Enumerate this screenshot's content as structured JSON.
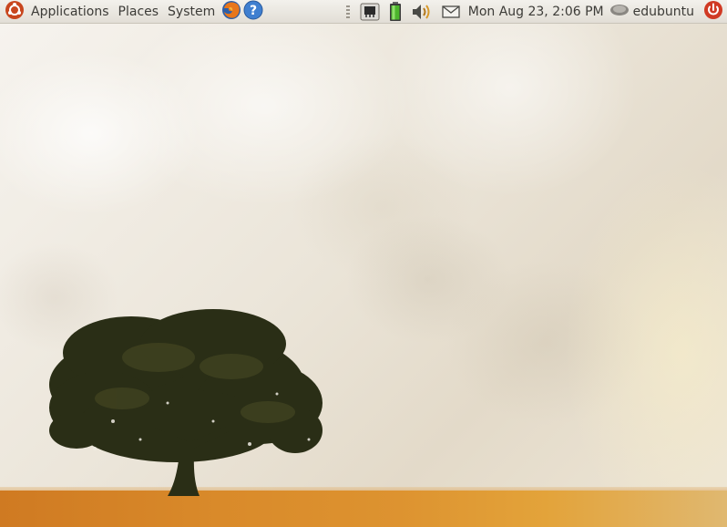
{
  "top_panel": {
    "main_menu": {
      "applications": "Applications",
      "places": "Places",
      "system": "System"
    },
    "launchers": [
      "firefox-icon",
      "help-icon"
    ],
    "tray_icons": [
      "network-icon",
      "battery-icon",
      "volume-icon",
      "mail-icon"
    ],
    "clock": "Mon Aug 23,  2:06 PM",
    "user": "edubuntu",
    "power_icon": "power-icon"
  },
  "colors": {
    "panel_bg": "#e8e5df",
    "accent_ubuntu": "#c8461e",
    "ground": "#d98a2a",
    "tree": "#2a2e16"
  },
  "desktop": {
    "wallpaper": "tree-on-orange-field"
  }
}
